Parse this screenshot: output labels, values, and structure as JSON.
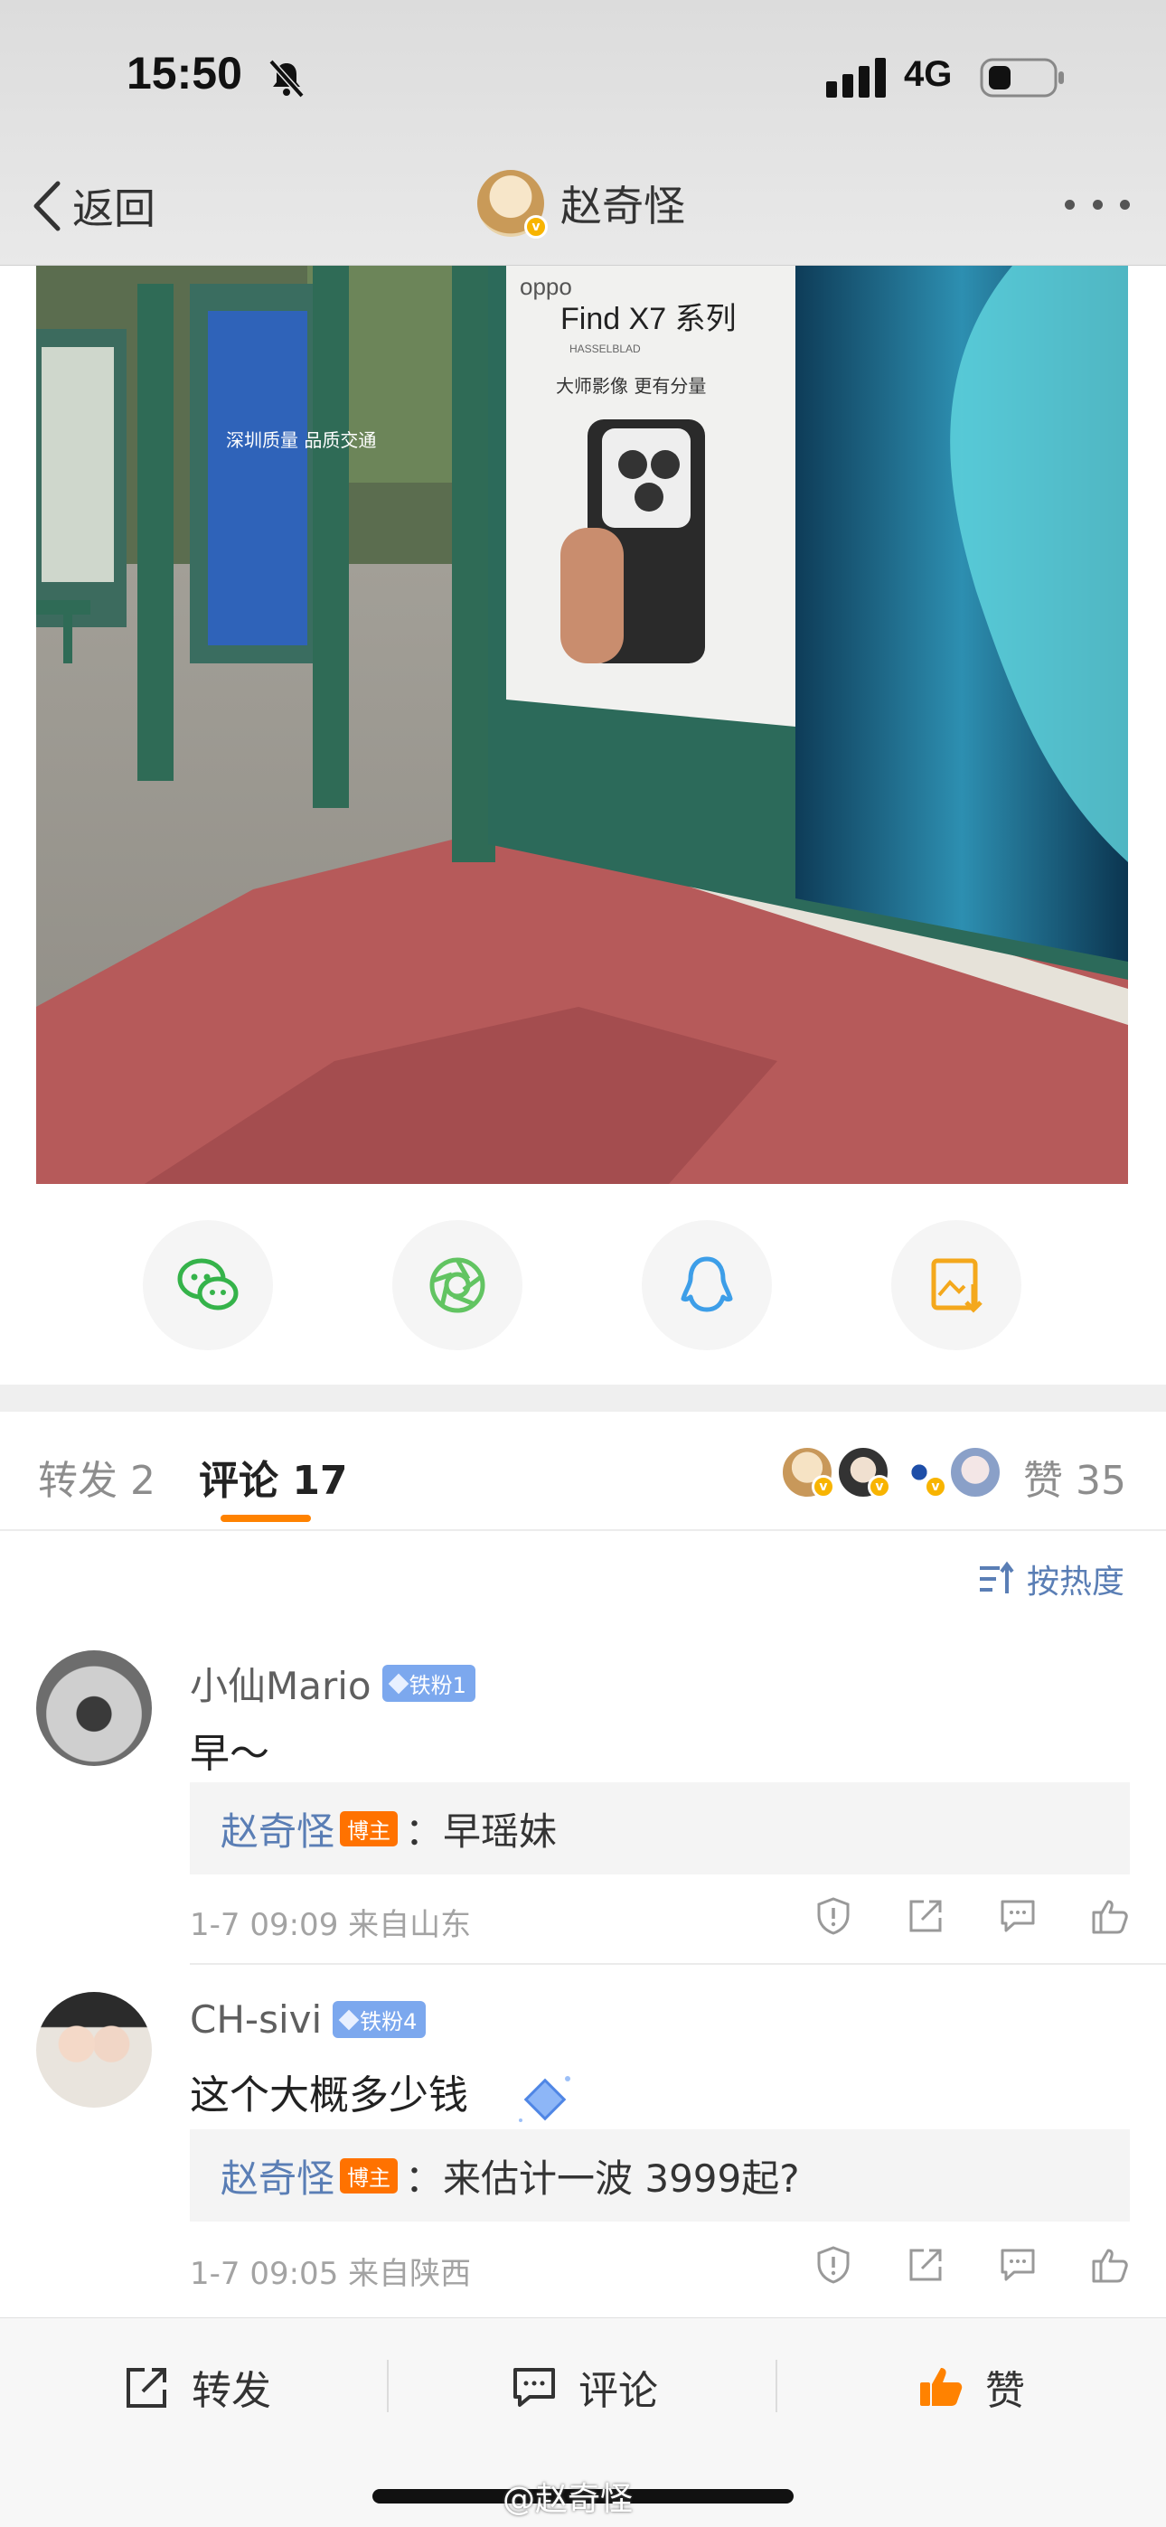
{
  "status_bar": {
    "time": "15:50",
    "network": "4G"
  },
  "nav": {
    "back_label": "返回",
    "author_name": "赵奇怪"
  },
  "photo": {
    "ad_brand": "oppo",
    "ad_title": "Find X7 系列",
    "ad_subtitle": "HASSELBLAD",
    "ad_slogan": "大师影像 更有分量",
    "sign_text": "深圳质量 品质交通"
  },
  "share_targets": [
    "wechat-icon",
    "moments-icon",
    "qq-icon",
    "save-image-icon"
  ],
  "tabs": {
    "repost": "转发 2",
    "comment": "评论 17",
    "likes": "赞 35"
  },
  "sort_label": "按热度",
  "comments": [
    {
      "name": "小仙Mario",
      "fan_badge": "铁粉1",
      "text": "早～",
      "reply_author": "赵奇怪",
      "host_badge": "博主",
      "reply_text": "：早瑶妹",
      "meta": "1-7 09:09  来自山东"
    },
    {
      "name": "CH-sivi",
      "fan_badge": "铁粉4",
      "text": "这个大概多少钱",
      "reply_author": "赵奇怪",
      "host_badge": "博主",
      "reply_text": "：来估计一波 3999起?",
      "meta": "1-7 09:05  来自陕西"
    }
  ],
  "bottom_bar": {
    "repost": "转发",
    "comment": "评论",
    "like": "赞"
  },
  "watermark": "@赵奇怪",
  "colors": {
    "accent": "#ff8200",
    "link": "#5a7eb5",
    "fan_badge": "#7ca8ee",
    "host_badge": "#ff7200"
  }
}
